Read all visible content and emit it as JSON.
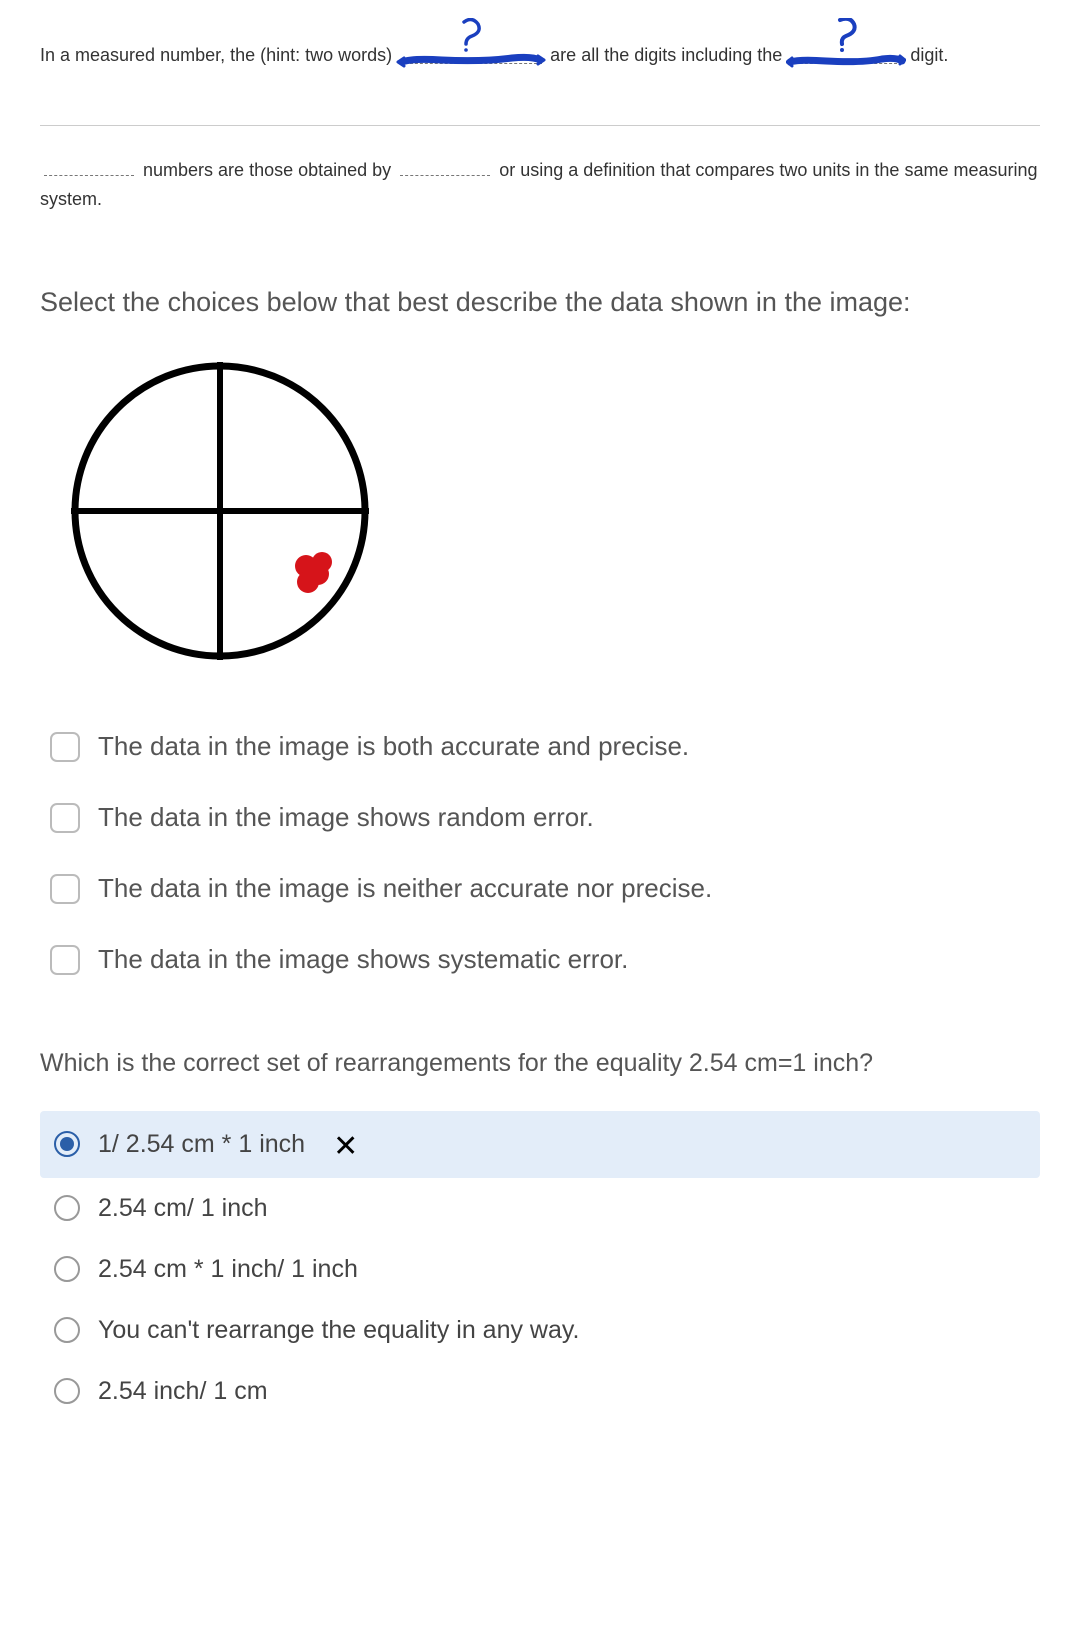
{
  "q1": {
    "part1": "In a measured number, the (hint: two words)",
    "part2": "are all the digits including the",
    "part3": "digit."
  },
  "q2": {
    "part1": "numbers are those obtained by",
    "part2": "or using a definition that compares two units in the same measuring system."
  },
  "q3": {
    "title": "Select the choices below that best describe the data shown in the image:",
    "options": [
      "The data in the image is both accurate and precise.",
      "The data in the image shows random error.",
      "The data in the image is neither accurate nor precise.",
      "The data in the image shows systematic error."
    ]
  },
  "q4": {
    "title": "Which is the correct set of rearrangements for the equality 2.54 cm=1 inch?",
    "options": [
      "1/ 2.54 cm * 1 inch",
      "2.54 cm/ 1 inch",
      "2.54 cm * 1 inch/ 1 inch",
      "You can't rearrange the equality in any way.",
      "2.54 inch/ 1 cm"
    ],
    "selectedIndex": 0,
    "wrongMark": "✕"
  }
}
